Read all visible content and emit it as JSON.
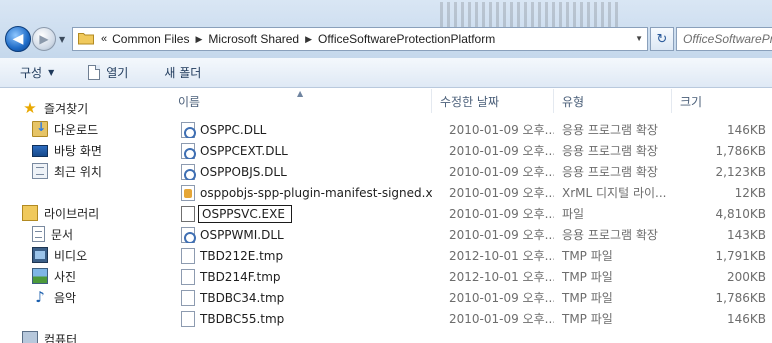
{
  "address": {
    "breadcrumb_prefix": "«",
    "crumbs": [
      "Common Files",
      "Microsoft Shared",
      "OfficeSoftwareProtectionPlatform"
    ],
    "search_placeholder": "OfficeSoftwareProtectionPlatform"
  },
  "toolbar": {
    "organize_label": "구성",
    "open_label": "열기",
    "new_folder_label": "새 폴더"
  },
  "nav": {
    "favorites_label": "즐겨찾기",
    "downloads_label": "다운로드",
    "desktop_label": "바탕 화면",
    "recent_label": "최근 위치",
    "libraries_label": "라이브러리",
    "documents_label": "문서",
    "videos_label": "비디오",
    "pictures_label": "사진",
    "music_label": "음악",
    "computer_label": "컴퓨터"
  },
  "columns": {
    "name": "이름",
    "date": "수정한 날짜",
    "type": "유형",
    "size": "크기"
  },
  "files": [
    {
      "name": "OSPPC.DLL",
      "date": "2010-01-09 오후...",
      "type": "응용 프로그램 확장",
      "size": "146KB",
      "icon": "dll"
    },
    {
      "name": "OSPPCEXT.DLL",
      "date": "2010-01-09 오후...",
      "type": "응용 프로그램 확장",
      "size": "1,786KB",
      "icon": "dll"
    },
    {
      "name": "OSPPOBJS.DLL",
      "date": "2010-01-09 오후...",
      "type": "응용 프로그램 확장",
      "size": "2,123KB",
      "icon": "dll"
    },
    {
      "name": "osppobjs-spp-plugin-manifest-signed.xr...",
      "date": "2010-01-09 오후...",
      "type": "XrML 디지털 라이...",
      "size": "12KB",
      "icon": "xml"
    },
    {
      "name": "OSPPSVC.EXE",
      "date": "2010-01-09 오후...",
      "type": "파일",
      "size": "4,810KB",
      "icon": "exe",
      "editing": true
    },
    {
      "name": "OSPPWMI.DLL",
      "date": "2010-01-09 오후...",
      "type": "응용 프로그램 확장",
      "size": "143KB",
      "icon": "dll"
    },
    {
      "name": "TBD212E.tmp",
      "date": "2012-10-01 오후...",
      "type": "TMP 파일",
      "size": "1,791KB",
      "icon": "file"
    },
    {
      "name": "TBD214F.tmp",
      "date": "2012-10-01 오후...",
      "type": "TMP 파일",
      "size": "200KB",
      "icon": "file"
    },
    {
      "name": "TBDBC34.tmp",
      "date": "2010-01-09 오후...",
      "type": "TMP 파일",
      "size": "1,786KB",
      "icon": "file"
    },
    {
      "name": "TBDBC55.tmp",
      "date": "2010-01-09 오후...",
      "type": "TMP 파일",
      "size": "146KB",
      "icon": "file"
    }
  ]
}
